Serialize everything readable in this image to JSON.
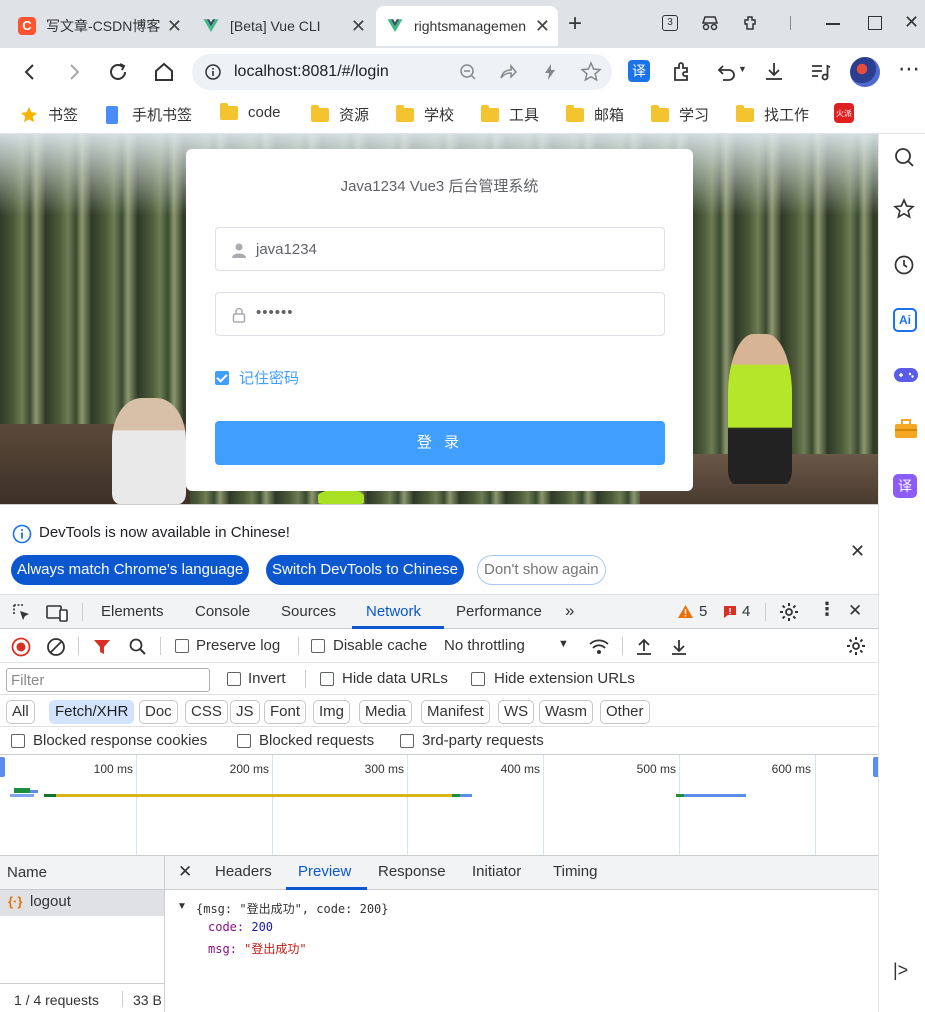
{
  "browser": {
    "tabs": [
      {
        "title": "写文章-CSDN博客",
        "favicon": "csdn-icon"
      },
      {
        "title": "[Beta] Vue CLI",
        "favicon": "vue-icon"
      },
      {
        "title": "rightsmanagement",
        "favicon": "vue-icon",
        "active": true
      }
    ],
    "tab_count_badge": "3",
    "url": "localhost:8081/#/login"
  },
  "bookmarks": [
    {
      "label": "书签",
      "icon": "star-icon"
    },
    {
      "label": "手机书签",
      "icon": "phone-icon"
    },
    {
      "label": "code",
      "icon": "folder-icon"
    },
    {
      "label": "资源",
      "icon": "folder-icon"
    },
    {
      "label": "学校",
      "icon": "folder-icon"
    },
    {
      "label": "工具",
      "icon": "folder-icon"
    },
    {
      "label": "邮箱",
      "icon": "folder-icon"
    },
    {
      "label": "学习",
      "icon": "folder-icon"
    },
    {
      "label": "找工作",
      "icon": "folder-icon"
    }
  ],
  "bookmark_badge": "火派",
  "login": {
    "title": "Java1234 Vue3 后台管理系统",
    "username": "java1234",
    "password_mask": "••••••",
    "remember_label": "记住密码",
    "remember_checked": true,
    "submit_label": "登 录"
  },
  "devtools": {
    "infobar": {
      "message": "DevTools is now available in Chinese!",
      "btn_match": "Always match Chrome's language",
      "btn_switch": "Switch DevTools to Chinese",
      "btn_dismiss": "Don't show again"
    },
    "tabs": [
      "Elements",
      "Console",
      "Sources",
      "Network",
      "Performance"
    ],
    "active_tab": "Network",
    "warnings": "5",
    "errors": "4",
    "network_toolbar": {
      "preserve_log": "Preserve log",
      "disable_cache": "Disable cache",
      "throttling": "No throttling"
    },
    "filter": {
      "placeholder": "Filter",
      "invert": "Invert",
      "hide_data_urls": "Hide data URLs",
      "hide_extension_urls": "Hide extension URLs"
    },
    "type_chips": [
      "All",
      "Fetch/XHR",
      "Doc",
      "CSS",
      "JS",
      "Font",
      "Img",
      "Media",
      "Manifest",
      "WS",
      "Wasm",
      "Other"
    ],
    "active_chip": "Fetch/XHR",
    "blocked": {
      "cookies": "Blocked response cookies",
      "requests": "Blocked requests",
      "third_party": "3rd-party requests"
    },
    "timeline_labels": [
      "100 ms",
      "200 ms",
      "300 ms",
      "400 ms",
      "500 ms",
      "600 ms"
    ],
    "requests": {
      "header": "Name",
      "items": [
        {
          "name": "logout",
          "icon": "xhr-icon"
        }
      ],
      "status": "1 / 4 requests",
      "size": "33 B"
    },
    "detail_tabs": [
      "Headers",
      "Preview",
      "Response",
      "Initiator",
      "Timing"
    ],
    "active_detail_tab": "Preview",
    "preview": {
      "summary": "{msg: \"登出成功\", code: 200}",
      "code_key": "code",
      "code_value": "200",
      "msg_key": "msg",
      "msg_value": "\"登出成功\""
    }
  },
  "colors": {
    "accent": "#409eff",
    "devtools_blue": "#0b57d0"
  }
}
